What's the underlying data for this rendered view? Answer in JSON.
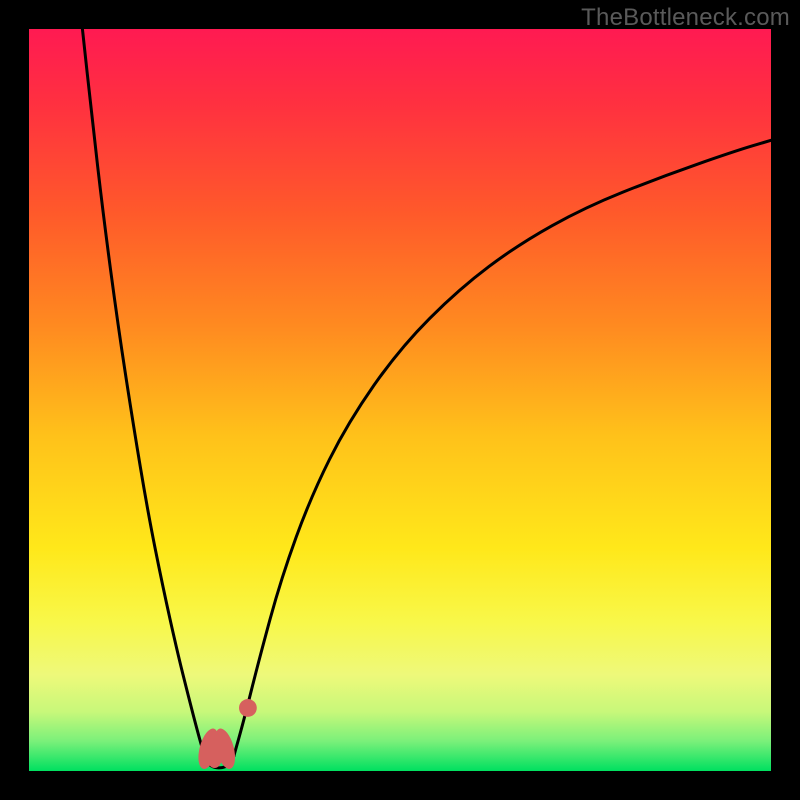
{
  "watermark": "TheBottleneck.com",
  "chart_data": {
    "type": "line",
    "title": "",
    "xlabel": "",
    "ylabel": "",
    "xlim": [
      0,
      100
    ],
    "ylim": [
      0,
      100
    ],
    "grid": false,
    "legend": false,
    "axes_visible": false,
    "background_gradient": {
      "stops": [
        {
          "offset": 0.0,
          "color": "#ff1a52"
        },
        {
          "offset": 0.1,
          "color": "#ff3040"
        },
        {
          "offset": 0.25,
          "color": "#ff5a2a"
        },
        {
          "offset": 0.4,
          "color": "#ff8a20"
        },
        {
          "offset": 0.55,
          "color": "#ffc21a"
        },
        {
          "offset": 0.7,
          "color": "#ffe81a"
        },
        {
          "offset": 0.8,
          "color": "#f8f84a"
        },
        {
          "offset": 0.87,
          "color": "#eef97a"
        },
        {
          "offset": 0.92,
          "color": "#c8f87a"
        },
        {
          "offset": 0.96,
          "color": "#7af07a"
        },
        {
          "offset": 1.0,
          "color": "#00e060"
        }
      ]
    },
    "series": [
      {
        "name": "curve-left",
        "x": [
          7.2,
          8.5,
          10.0,
          12.0,
          14.0,
          16.0,
          18.0,
          20.0,
          21.5,
          22.8,
          23.6
        ],
        "y": [
          100.0,
          88.0,
          75.0,
          60.0,
          47.0,
          35.0,
          25.0,
          16.0,
          10.0,
          5.0,
          2.2
        ]
      },
      {
        "name": "curve-right",
        "x": [
          27.6,
          29.0,
          31.0,
          34.0,
          38.0,
          43.0,
          50.0,
          58.0,
          66.0,
          75.0,
          85.0,
          95.0,
          100.0
        ],
        "y": [
          2.0,
          7.0,
          15.0,
          26.0,
          37.0,
          47.0,
          57.0,
          65.0,
          71.0,
          76.0,
          80.0,
          83.5,
          85.0
        ]
      },
      {
        "name": "notch-arc",
        "x": [
          23.6,
          24.1,
          24.8,
          25.6,
          26.4,
          27.1,
          27.6
        ],
        "y": [
          2.2,
          1.0,
          0.5,
          0.4,
          0.5,
          1.0,
          2.0
        ]
      }
    ],
    "markers": [
      {
        "name": "marker-notch-left",
        "kind": "pill",
        "cx": 24.2,
        "cy": 3.0,
        "rx": 1.2,
        "ry": 2.8,
        "angle": 15,
        "color": "#d6605e"
      },
      {
        "name": "marker-notch-mid",
        "kind": "pill",
        "cx": 25.0,
        "cy": 1.8,
        "rx": 1.0,
        "ry": 1.4,
        "angle": 0,
        "color": "#d6605e"
      },
      {
        "name": "marker-notch-right",
        "kind": "pill",
        "cx": 26.4,
        "cy": 3.0,
        "rx": 1.2,
        "ry": 2.8,
        "angle": -15,
        "color": "#d6605e"
      },
      {
        "name": "marker-dot",
        "kind": "dot",
        "cx": 29.5,
        "cy": 8.5,
        "r": 1.2,
        "color": "#d6605e"
      }
    ]
  }
}
